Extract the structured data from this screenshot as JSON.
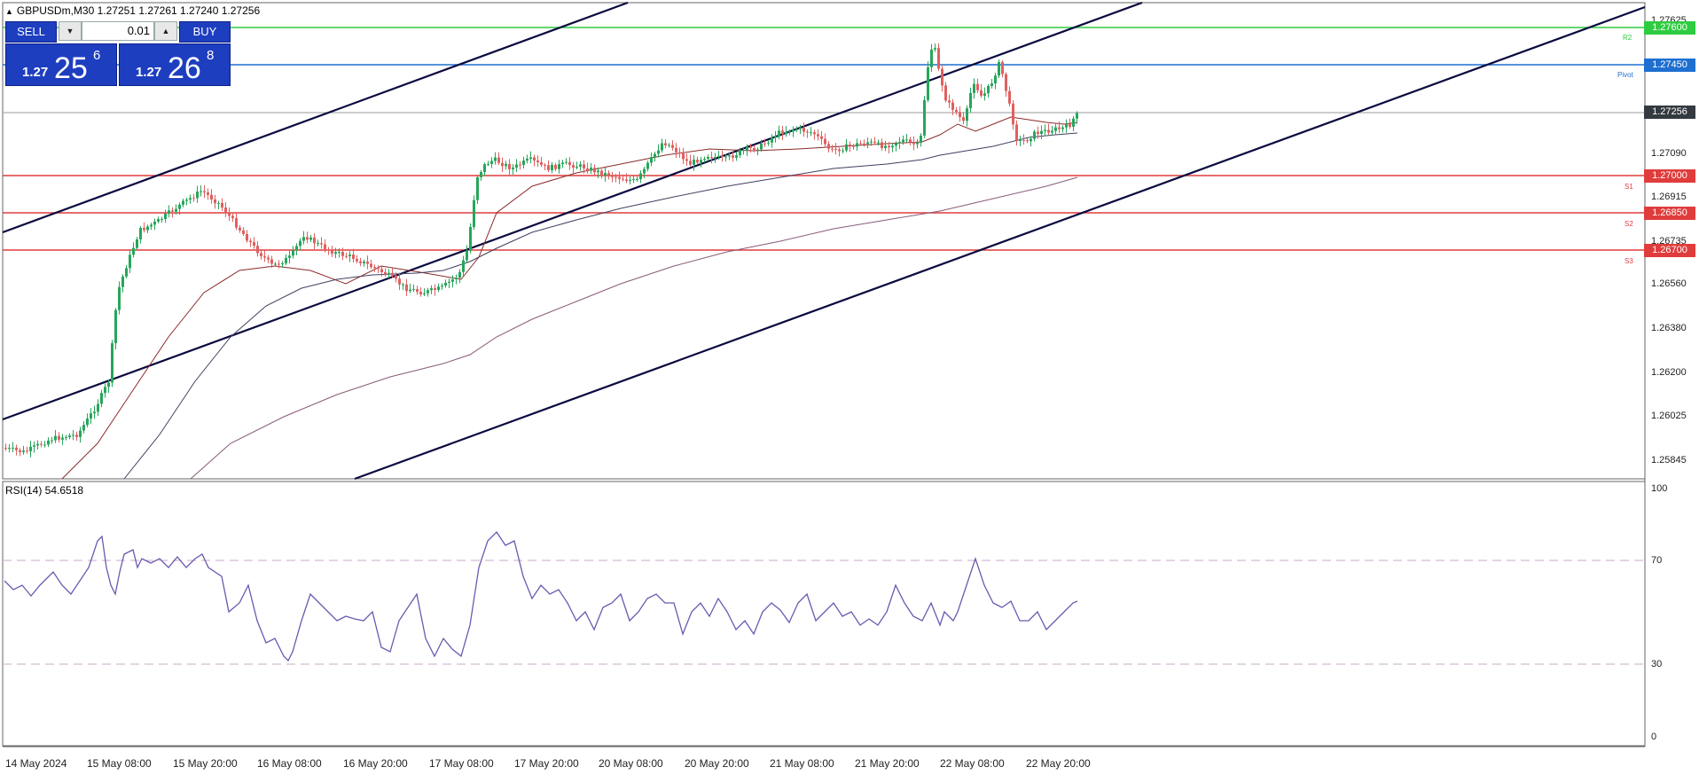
{
  "header": {
    "symbol_line": "GBPUSDm,M30  1.27251 1.27261 1.27240 1.27256"
  },
  "trade_panel": {
    "sell_label": "SELL",
    "buy_label": "BUY",
    "lot": "0.01",
    "sell_prefix": "1.27",
    "sell_big": "25",
    "sell_sup": "6",
    "buy_prefix": "1.27",
    "buy_big": "26",
    "buy_sup": "8"
  },
  "price_axis": [
    "1.27625",
    "1.27090",
    "1.26915",
    "1.26735",
    "1.26560",
    "1.26380",
    "1.26200",
    "1.26025",
    "1.25845"
  ],
  "level_tags": {
    "r2": {
      "value": "1.27600",
      "color": "#2ecc40"
    },
    "pivot": {
      "value": "1.27450",
      "color": "#1e6fd0"
    },
    "current": {
      "value": "1.27256",
      "color": "#333a40"
    },
    "s1": {
      "value": "1.27000",
      "color": "#e03c3c"
    },
    "s2": {
      "value": "1.26850",
      "color": "#e03c3c"
    },
    "s3": {
      "value": "1.26700",
      "color": "#e03c3c"
    }
  },
  "level_names": {
    "r2": "R2",
    "pivot": "Pivot",
    "s1": "S1",
    "s2": "S2",
    "s3": "S3"
  },
  "rsi": {
    "label": "RSI(14) 54.6518",
    "axis": [
      "100",
      "70",
      "30",
      "0"
    ]
  },
  "time_axis": [
    "14 May 2024",
    "15 May 08:00",
    "15 May 20:00",
    "16 May 08:00",
    "16 May 20:00",
    "17 May 08:00",
    "17 May 20:00",
    "20 May 08:00",
    "20 May 20:00",
    "21 May 08:00",
    "21 May 20:00",
    "22 May 08:00",
    "22 May 20:00"
  ]
}
